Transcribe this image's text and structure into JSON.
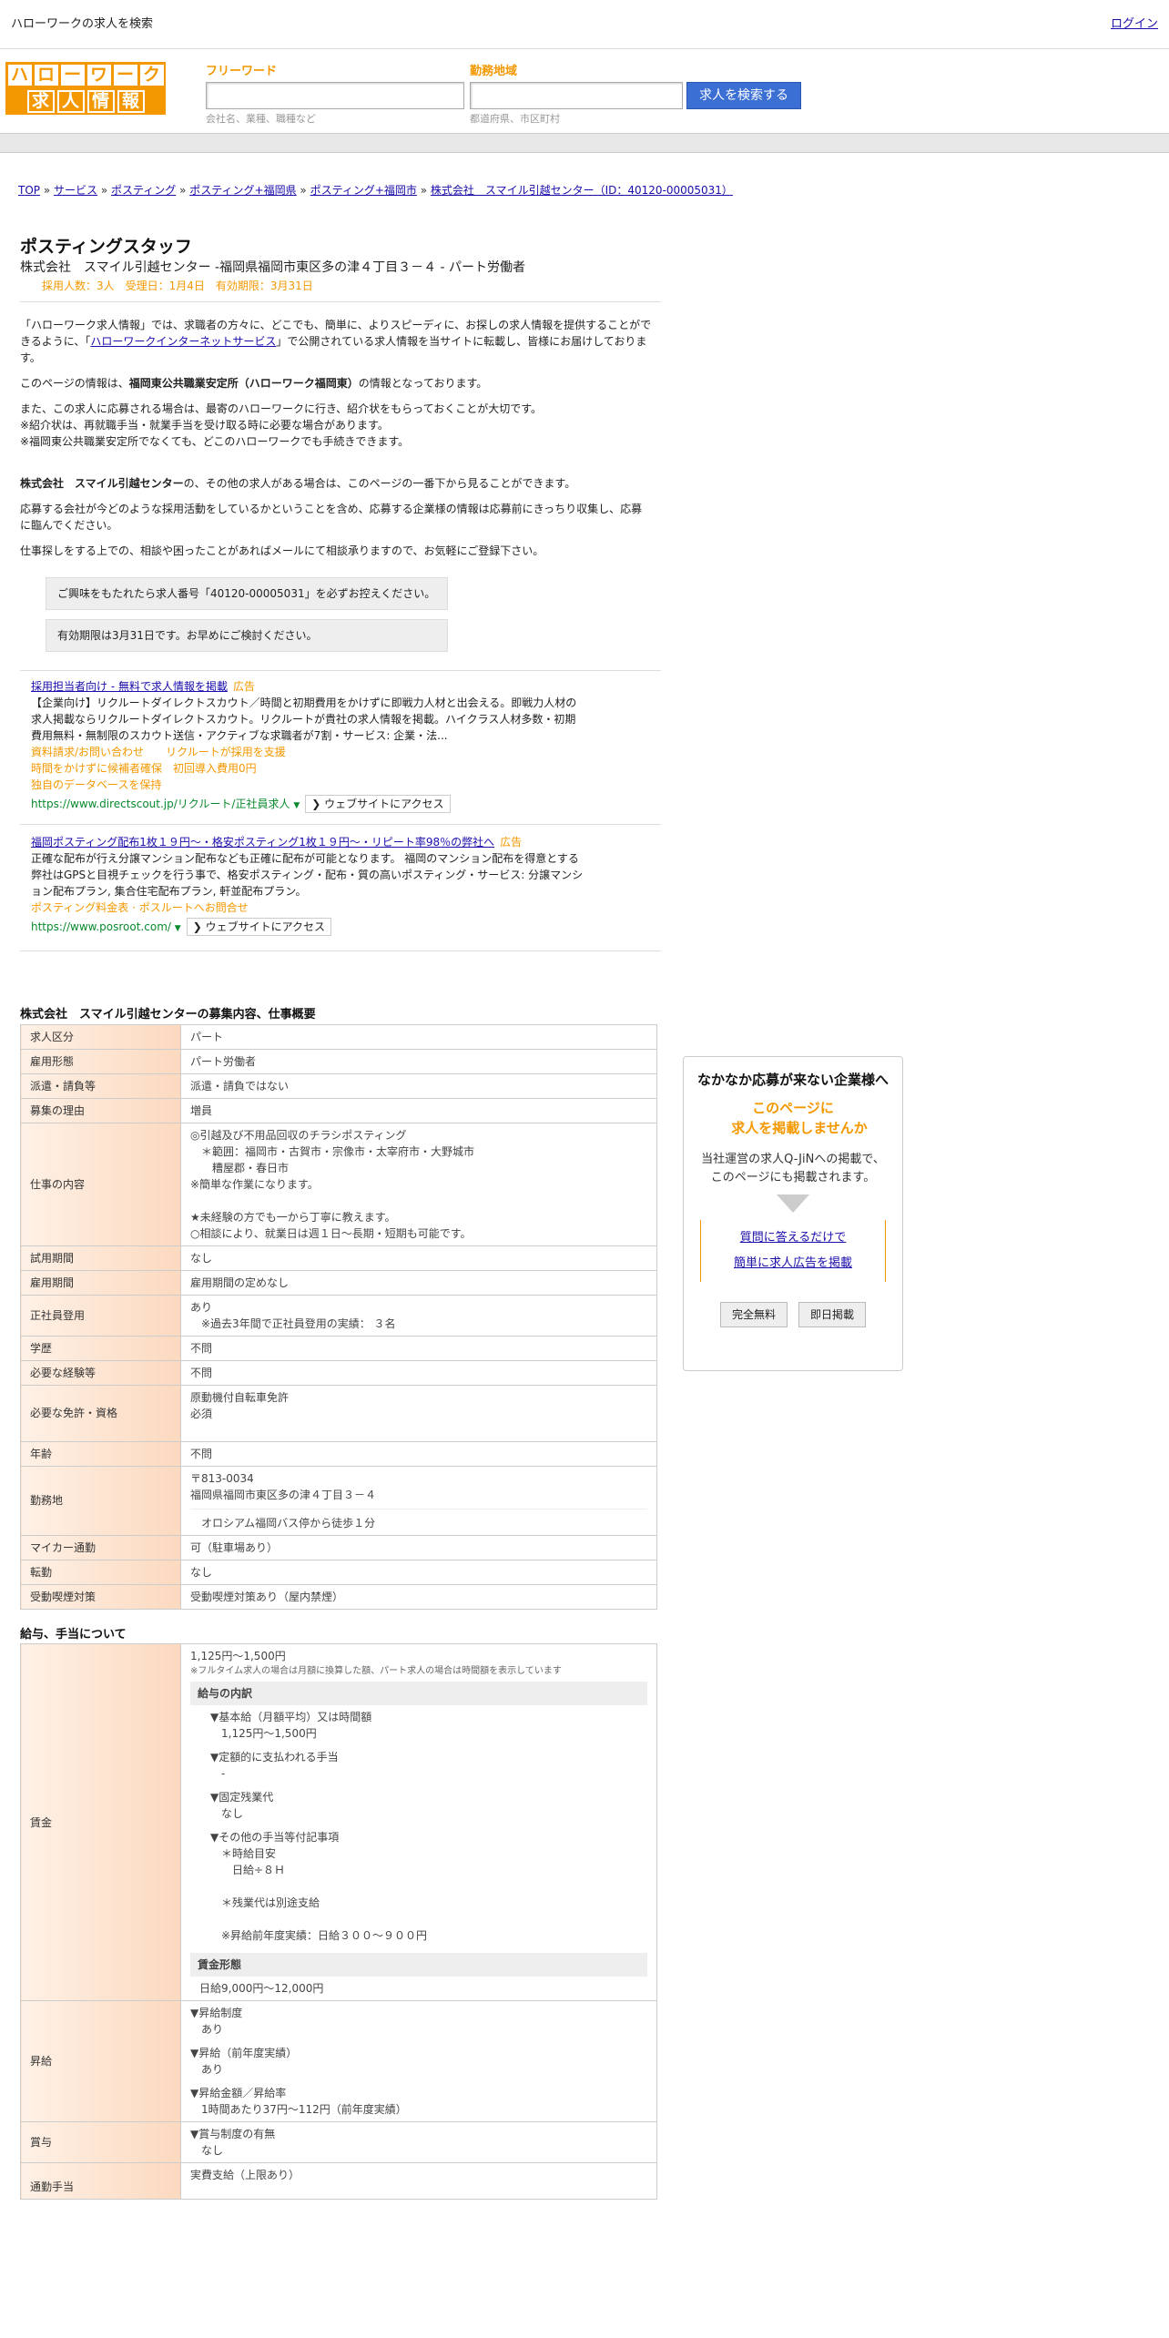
{
  "topbar": {
    "title": "ハローワークの求人を検索",
    "login": "ログイン"
  },
  "logo": {
    "row1": [
      "ハ",
      "ロ",
      "ー",
      "ワ",
      "ー",
      "ク"
    ],
    "row2": [
      "求",
      "人",
      "情",
      "報"
    ]
  },
  "search": {
    "free_label": "フリーワード",
    "free_hint": "会社名、業種、職種など",
    "area_label": "勤務地域",
    "area_hint": "都道府県、市区町村",
    "button": "求人を検索する"
  },
  "breadcrumb": [
    "TOP",
    "サービス",
    "ポスティング",
    "ポスティング+福岡県",
    "ポスティング+福岡市",
    "株式会社　スマイル引越センター（ID：40120-00005031）"
  ],
  "job": {
    "title": "ポスティングスタッフ",
    "subtitle": "株式会社　スマイル引越センター -福岡県福岡市東区多の津４丁目３－４ - パート労働者",
    "meta": "採用人数：3人　受理日：1月4日　有効期限：3月31日"
  },
  "intro": {
    "p1_a": "「ハローワーク求人情報」では、求職者の方々に、どこでも、簡単に、よりスピーディに、お探しの求人情報を提供することができるように、「",
    "p1_link": "ハローワークインターネットサービス",
    "p1_b": "」で公開されている求人情報を当サイトに転載し、皆様にお届けしております。",
    "p2_a": "このページの情報は、",
    "p2_bold": "福岡東公共職業安定所（ハローワーク福岡東）",
    "p2_b": "の情報となっております。",
    "p3": "また、この求人に応募される場合は、最寄のハローワークに行き、紹介状をもらっておくことが大切です。",
    "p4": "※紹介状は、再就職手当・就業手当を受け取る時に必要な場合があります。",
    "p5": "※福岡東公共職業安定所でなくても、どこのハローワークでも手続きできます。",
    "p6_bold": "株式会社　スマイル引越センター",
    "p6": "の、その他の求人がある場合は、このページの一番下から見ることができます。",
    "p7": "応募する会社が今どのような採用活動をしているかということを含め、応募する企業様の情報は応募前にきっちり収集し、応募に臨んでください。",
    "p8": "仕事探しをする上での、相談や困ったことがあればメールにて相談承りますので、お気軽にご登録下さい。"
  },
  "notes": {
    "n1": "ご興味をもたれたら求人番号「40120-00005031」を必ずお控えください。",
    "n2": "有効期限は3月31日です。お早めにご検討ください。"
  },
  "ads": [
    {
      "headline": "採用担当者向け - 無料で求人情報を掲載",
      "label": "広告",
      "body": "【企業向け】リクルートダイレクトスカウト／時間と初期費用をかけずに即戦力人材と出会える。即戦力人材の求人掲載ならリクルートダイレクトスカウト。リクルートが貴社の求人情報を掲載。ハイクラス人材多数・初期費用無料・無制限のスカウト送信・アクティブな求職者が7割・サービス: 企業・法...",
      "links": [
        "資料請求/お問い合わせ",
        "リクルートが採用を支援",
        "時間をかけずに候補者確保　初回導入費用0円",
        "独自のデータベースを保持"
      ],
      "url": "https://www.directscout.jp/リクルート/正社員求人",
      "visit": "ウェブサイトにアクセス"
    },
    {
      "headline": "福岡ポスティング配布1枚１９円～・格安ポスティング1枚１９円～・リピート率98％の弊社へ",
      "label": "広告",
      "body": "正確な配布が行え分譲マンション配布なども正確に配布が可能となります。 福岡のマンション配布を得意とする弊社はGPSと目視チェックを行う事で、格安ポスティング・配布・質の高いポスティング・サービス: 分譲マンション配布プラン, 集合住宅配布プラン, 軒並配布プラン。",
      "links": [
        "ポスティング料金表 · ポスルートへお問合せ"
      ],
      "url": "https://www.posroot.com/",
      "visit": "ウェブサイトにアクセス"
    }
  ],
  "summary_title": "株式会社　スマイル引越センターの募集内容、仕事概要",
  "summary": [
    {
      "k": "求人区分",
      "v": "パート"
    },
    {
      "k": "雇用形態",
      "v": "パート労働者"
    },
    {
      "k": "派遣・請負等",
      "v": "派遣・請負ではない"
    },
    {
      "k": "募集の理由",
      "v": "増員"
    },
    {
      "k": "仕事の内容",
      "v": [
        "◎引越及び不用品回収のチラシポスティング",
        "　＊範囲：福岡市・古賀市・宗像市・太宰府市・大野城市",
        "　　糟屋郡・春日市",
        "※簡単な作業になります。",
        "",
        "★未経験の方でも一から丁寧に教えます。",
        "○相談により、就業日は週１日～長期・短期も可能です。"
      ]
    },
    {
      "k": "試用期間",
      "v": "なし"
    },
    {
      "k": "雇用期間",
      "v": "雇用期間の定めなし"
    },
    {
      "k": "正社員登用",
      "v": [
        "あり",
        "　※過去3年間で正社員登用の実績： ３名"
      ]
    },
    {
      "k": "学歴",
      "v": "不問"
    },
    {
      "k": "必要な経験等",
      "v": "不問"
    },
    {
      "k": "必要な免許・資格",
      "v": [
        "原動機付自転車免許",
        "必須"
      ]
    },
    {
      "k": "年齢",
      "v": "不問"
    },
    {
      "k": "勤務地",
      "v": [
        "〒813-0034",
        "福岡県福岡市東区多の津４丁目３－４",
        "",
        "　オロシアム福岡バス停から徒歩１分"
      ]
    },
    {
      "k": "マイカー通勤",
      "v": "可（駐車場あり）"
    },
    {
      "k": "転勤",
      "v": "なし"
    },
    {
      "k": "受動喫煙対策",
      "v": "受動喫煙対策あり（屋内禁煙）"
    }
  ],
  "salary_title": "給与、手当について",
  "salary": {
    "k": "賃金",
    "range": "1,125円〜1,500円",
    "note": "※フルタイム求人の場合は月額に換算した額、パート求人の場合は時間額を表示しています",
    "breakdown_title": "給与の内訳",
    "lines": [
      "▼基本給（月額平均）又は時間額",
      "　1,125円〜1,500円",
      "",
      "▼定額的に支払われる手当",
      "　-",
      "",
      "▼固定残業代",
      "　なし",
      "",
      "▼その他の手当等付記事項",
      "　＊時給目安",
      "　　日給÷８Ｈ",
      "",
      "　＊残業代は別途支給",
      "",
      "　※昇給前年度実績：日給３００～９００円"
    ],
    "form_title": "賃金形態",
    "form_value": "日給9,000円〜12,000円"
  },
  "raise": {
    "k": "昇給",
    "v": [
      "▼昇給制度",
      "　あり",
      "",
      "▼昇給（前年度実績）",
      "　あり",
      "",
      "▼昇給金額／昇給率",
      "　1時間あたり37円〜112円（前年度実績）"
    ]
  },
  "bonus": {
    "k": "賞与",
    "v": [
      "▼賞与制度の有無",
      "　なし"
    ]
  },
  "commute": {
    "k": "通勤手当",
    "v": "実費支給（上限あり）"
  },
  "side": {
    "heading": "なかなか応募が来ない企業様へ",
    "orange1": "このページに",
    "orange2": "求人を掲載しませんか",
    "desc1": "当社運営の求人Q-JiNへの掲載で、",
    "desc2": "このページにも掲載されます。",
    "link1": "質問に答えるだけで",
    "link2": "簡単に求人広告を掲載",
    "btn1": "完全無料",
    "btn2": "即日掲載"
  }
}
